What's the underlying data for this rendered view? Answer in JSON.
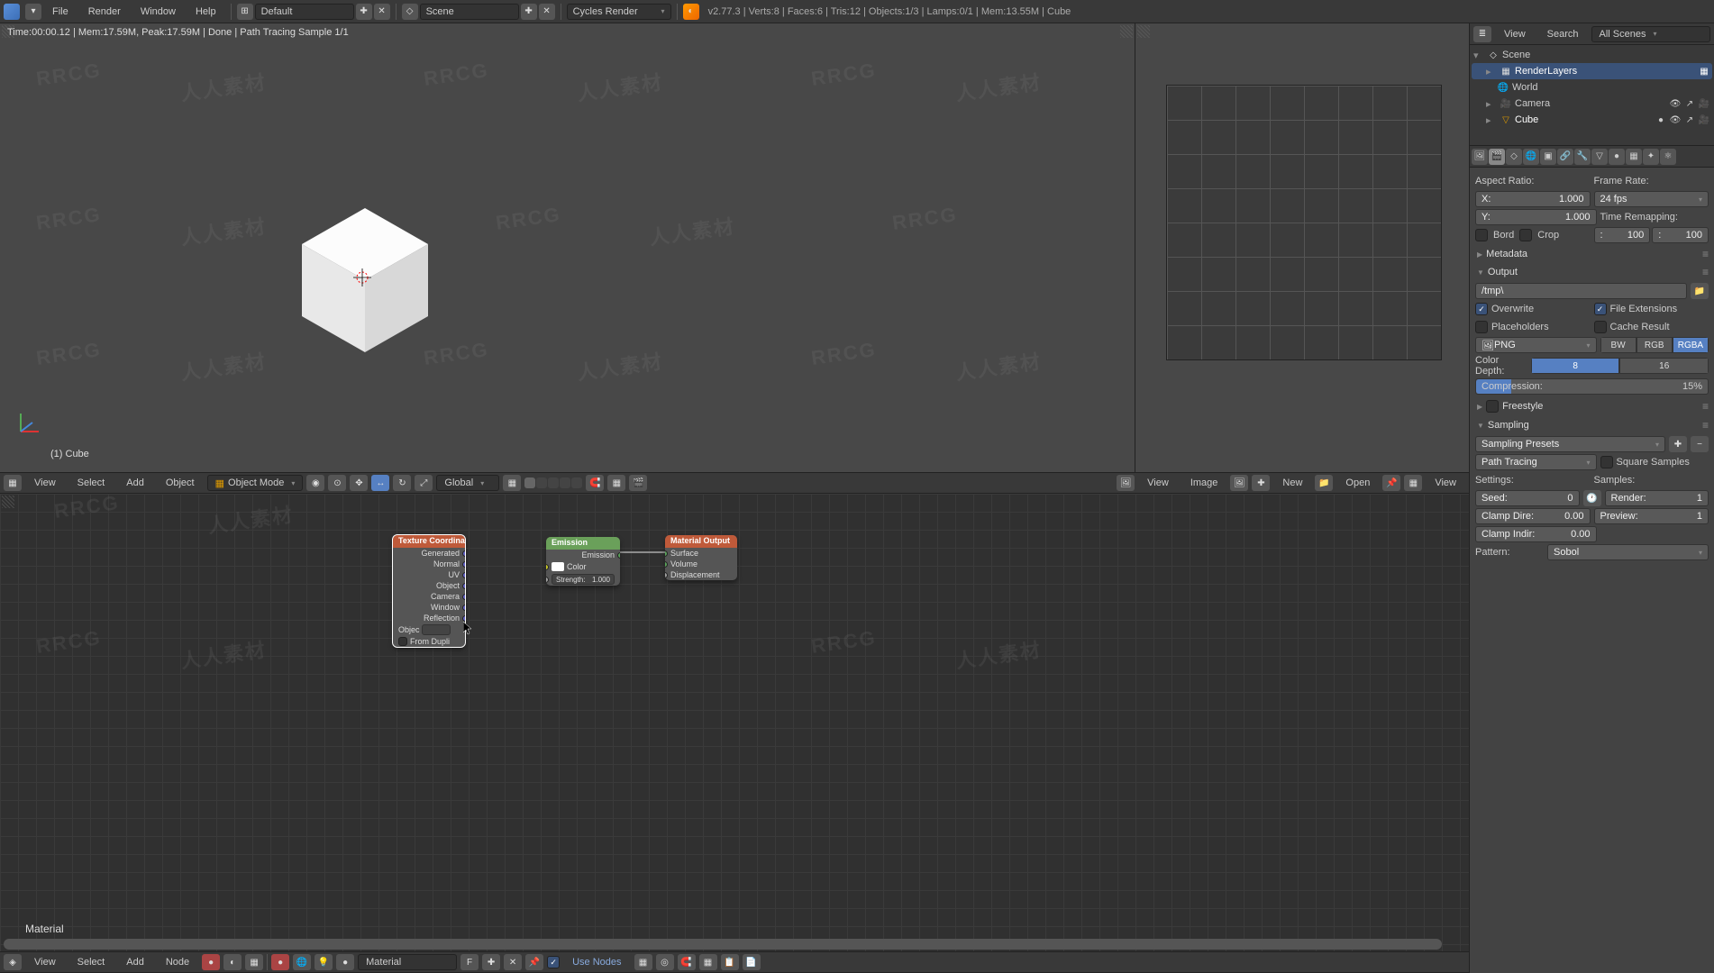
{
  "menubar": {
    "file": "File",
    "render": "Render",
    "window": "Window",
    "help": "Help",
    "layout": "Default",
    "scene": "Scene",
    "engine": "Cycles Render",
    "stats": "v2.77.3 | Verts:8 | Faces:6 | Tris:12 | Objects:1/3 | Lamps:0/1 | Mem:13.55M | Cube"
  },
  "infobar": "Time:00:00.12 | Mem:17.59M, Peak:17.59M | Done | Path Tracing Sample 1/1",
  "viewport3d": {
    "view": "View",
    "select": "Select",
    "add": "Add",
    "object": "Object",
    "mode": "Object Mode",
    "orientation": "Global",
    "object_label": "(1) Cube"
  },
  "image_editor": {
    "view": "View",
    "image": "Image",
    "new": "New",
    "open": "Open",
    "view2": "View"
  },
  "node_editor": {
    "view": "View",
    "select": "Select",
    "add": "Add",
    "node": "Node",
    "material_name": "Material",
    "use_nodes_label": "Use Nodes",
    "use_nodes_checked": true,
    "breadcrumb": "Material"
  },
  "outliner": {
    "view": "View",
    "search": "Search",
    "filter": "All Scenes",
    "tree": {
      "scene": "Scene",
      "renderlayers": "RenderLayers",
      "world": "World",
      "camera": "Camera",
      "cube": "Cube"
    }
  },
  "properties": {
    "aspect_ratio": "Aspect Ratio:",
    "x_label": "X:",
    "x_val": "1.000",
    "y_label": "Y:",
    "y_val": "1.000",
    "frame_rate": "Frame Rate:",
    "frame_rate_val": "24 fps",
    "time_remap": "Time Remapping:",
    "remap_old": "100",
    "remap_new": "100",
    "border": "Bord",
    "crop": "Crop",
    "metadata": "Metadata",
    "output": "Output",
    "output_path": "/tmp\\",
    "overwrite": "Overwrite",
    "file_ext": "File Extensions",
    "placeholders": "Placeholders",
    "cache_result": "Cache Result",
    "format": "PNG",
    "color_bw": "BW",
    "color_rgb": "RGB",
    "color_rgba": "RGBA",
    "color_depth": "Color Depth:",
    "depth_8": "8",
    "depth_16": "16",
    "compression": "Compression:",
    "compression_val": "15%",
    "freestyle": "Freestyle",
    "sampling": "Sampling",
    "sampling_presets": "Sampling Presets",
    "integrator": "Path Tracing",
    "square_samples": "Square Samples",
    "settings": "Settings:",
    "samples": "Samples:",
    "seed": "Seed:",
    "seed_val": "0",
    "render_samples": "Render:",
    "render_val": "1",
    "preview_samples": "Preview:",
    "preview_val": "1",
    "clamp_direct": "Clamp Dire:",
    "clamp_direct_val": "0.00",
    "clamp_indirect": "Clamp Indir:",
    "clamp_indirect_val": "0.00",
    "pattern": "Pattern:",
    "pattern_val": "Sobol"
  },
  "nodes": {
    "texcoord": {
      "title": "Texture Coordinate",
      "generated": "Generated",
      "normal": "Normal",
      "uv": "UV",
      "object_out": "Object",
      "camera": "Camera",
      "window": "Window",
      "reflection": "Reflection",
      "object_field": "Objec",
      "from_dupli": "From Dupli"
    },
    "emission": {
      "title": "Emission",
      "emission_out": "Emission",
      "color": "Color",
      "strength_label": "Strength:",
      "strength_val": "1.000"
    },
    "material_output": {
      "title": "Material Output",
      "surface": "Surface",
      "volume": "Volume",
      "displacement": "Displacement"
    }
  },
  "watermarks": [
    "RRCG",
    "人人素材"
  ]
}
